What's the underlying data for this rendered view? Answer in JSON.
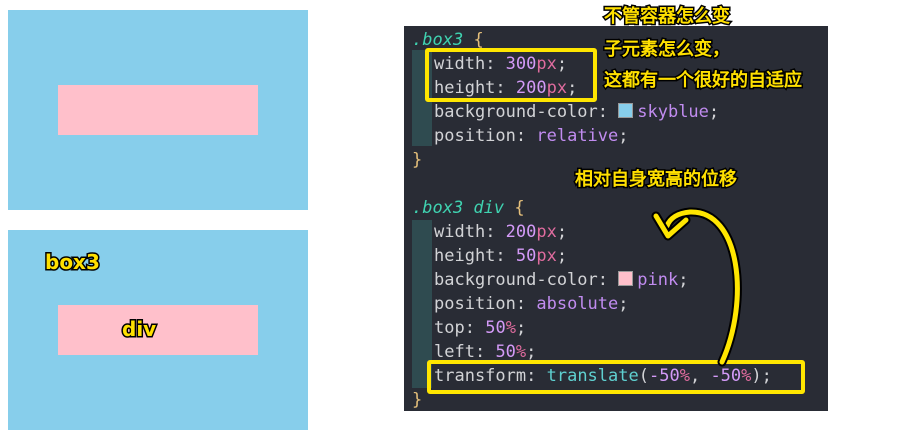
{
  "annotations": {
    "note_1": "不管容器怎么变",
    "note_2": "子元素怎么变，",
    "note_3": "这都有一个很好的自适应",
    "arrow_note": "相对自身宽高的位移",
    "box_label": "box3",
    "div_label": "div"
  },
  "code": {
    "sel1": ".box3",
    "open": "{",
    "close": "}",
    "sel2": ".box3 div",
    "width_prop": "width",
    "height_prop": "height",
    "bg_prop": "background-color",
    "pos_prop": "position",
    "top_prop": "top",
    "left_prop": "left",
    "transform_prop": "transform",
    "w1_num": "300",
    "px": "px",
    "h1_num": "200",
    "bg1_val": "skyblue",
    "pos1_val": "relative",
    "w2_num": "200",
    "h2_num": "50",
    "bg2_val": "pink",
    "pos2_val": "absolute",
    "top_num": "50",
    "left_num": "50",
    "pct": "%",
    "translate_fn": "translate",
    "tx": "-50",
    "ty": "-50"
  },
  "colors": {
    "skyblue": "#87ceeb",
    "pink": "#ffc0cb",
    "highlight": "#ffe600"
  }
}
